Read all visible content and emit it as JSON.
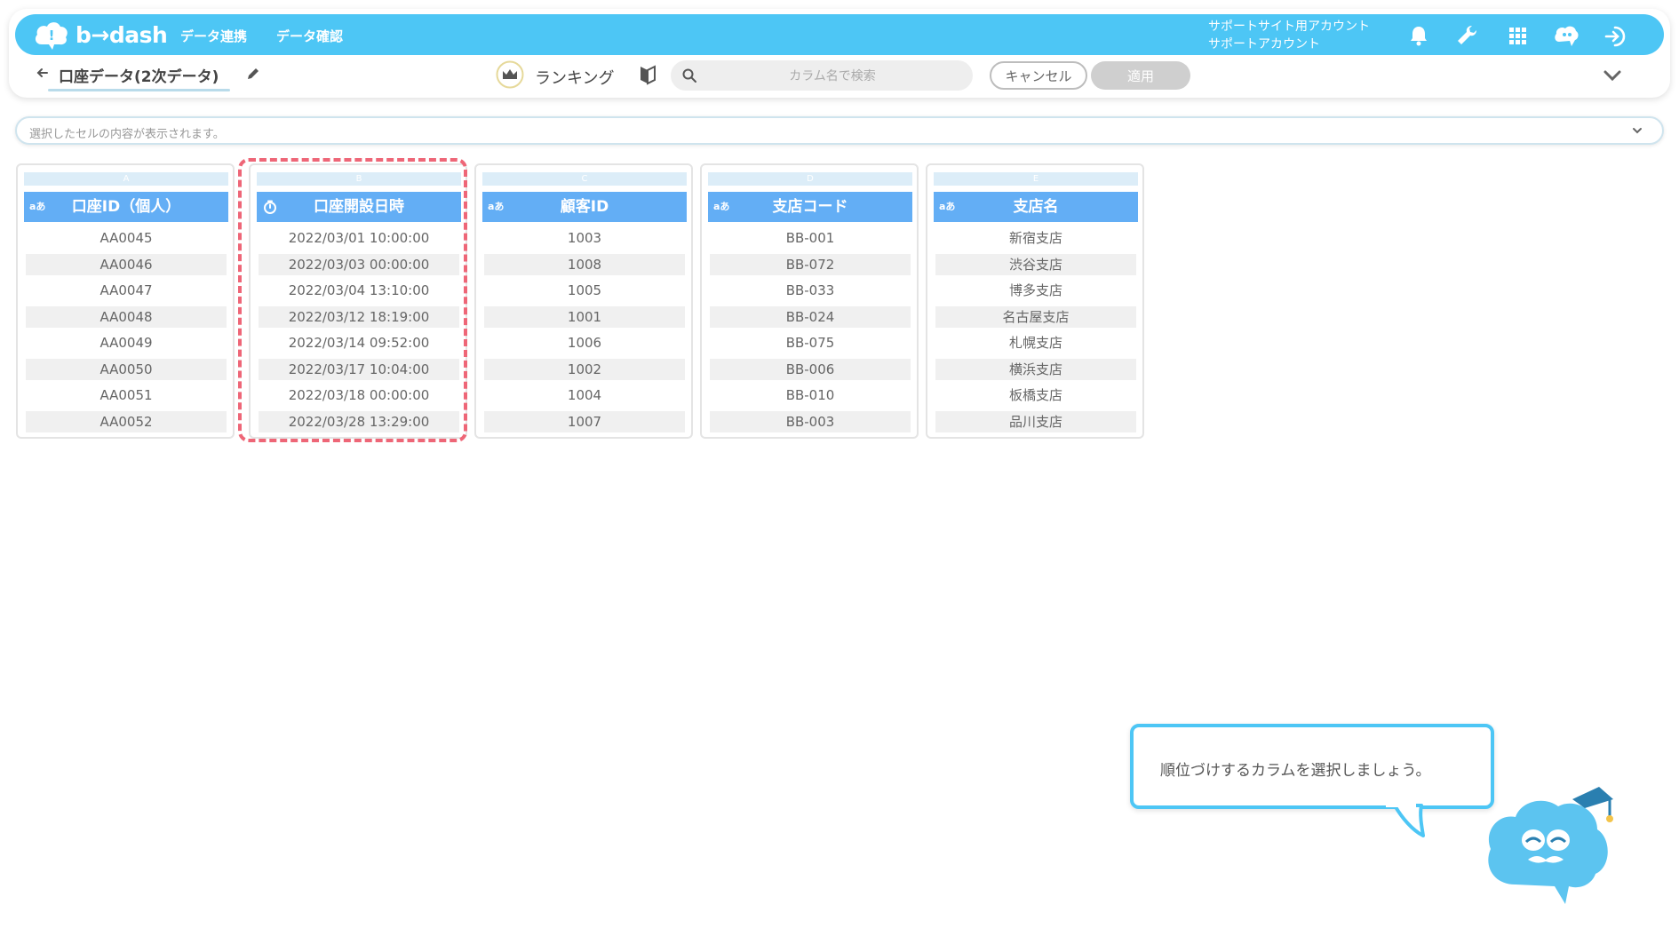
{
  "navbar": {
    "logo_text": "b→dash",
    "links": [
      "データ連携",
      "データ確認"
    ],
    "account_line1": "サポートサイト用アカウント",
    "account_line2": "サポートアカウント",
    "icons": [
      "bell-icon",
      "wrench-icon",
      "grid-icon",
      "mascot-chat-icon",
      "logout-icon"
    ]
  },
  "toolbar": {
    "title": "口座データ(2次データ)",
    "ranking_label": "ランキング",
    "search_placeholder": "カラム名で検索",
    "cancel_label": "キャンセル",
    "apply_label": "適用"
  },
  "cell_bar": {
    "placeholder": "選択したセルの内容が表示されます。"
  },
  "table": {
    "columns": [
      {
        "letter": "A",
        "type": "text",
        "type_label": "aあ",
        "header": "口座ID（個人）",
        "values": [
          "AA0045",
          "AA0046",
          "AA0047",
          "AA0048",
          "AA0049",
          "AA0050",
          "AA0051",
          "AA0052"
        ]
      },
      {
        "letter": "B",
        "type": "datetime",
        "type_label": "",
        "header": "口座開設日時",
        "values": [
          "2022/03/01 10:00:00",
          "2022/03/03 00:00:00",
          "2022/03/04 13:10:00",
          "2022/03/12 18:19:00",
          "2022/03/14 09:52:00",
          "2022/03/17 10:04:00",
          "2022/03/18 00:00:00",
          "2022/03/28 13:29:00"
        ]
      },
      {
        "letter": "C",
        "type": "text",
        "type_label": "aあ",
        "header": "顧客ID",
        "values": [
          "1003",
          "1008",
          "1005",
          "1001",
          "1006",
          "1002",
          "1004",
          "1007"
        ]
      },
      {
        "letter": "D",
        "type": "text",
        "type_label": "aあ",
        "header": "支店コード",
        "values": [
          "BB-001",
          "BB-072",
          "BB-033",
          "BB-024",
          "BB-075",
          "BB-006",
          "BB-010",
          "BB-003"
        ]
      },
      {
        "letter": "E",
        "type": "text",
        "type_label": "aあ",
        "header": "支店名",
        "values": [
          "新宿支店",
          "渋谷支店",
          "博多支店",
          "名古屋支店",
          "札幌支店",
          "横浜支店",
          "板橋支店",
          "品川支店"
        ]
      }
    ]
  },
  "tooltip": {
    "text": "順位づけするカラムを選択しましょう。"
  },
  "colors": {
    "brand": "#4dc6f5",
    "header": "#63aef5",
    "highlight": "#ee6677"
  }
}
